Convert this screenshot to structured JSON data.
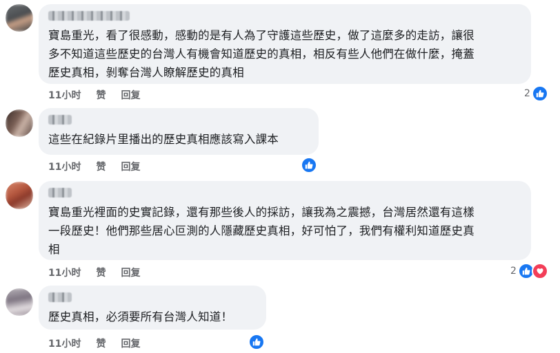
{
  "comments": [
    {
      "text": "寶島重光，看了很感動，感動的是有人為了守護這些歷史，做了這麼多的走訪，讓很\n多不知道這些歷史的台灣人有機會知道歷史的真相，相反有些人他們在做什麼，掩蓋\n歷史真相，剝奪台灣人瞭解歷史的真相",
      "time": "11小时",
      "like": "赞",
      "reply": "回复",
      "reaction_count": "2",
      "reactions": [
        "like-icon"
      ]
    },
    {
      "text": "這些在紀錄片里播出的歷史真相應該寫入課本",
      "time": "11小时",
      "like": "赞",
      "reply": "回复",
      "reaction_count": "",
      "reactions": [
        "like-icon"
      ]
    },
    {
      "text": "寶島重光裡面的史實記錄，還有那些後人的採訪，讓我為之震撼，台灣居然還有這樣\n一段歷史！他們那些居心叵測的人隱藏歷史真相，好可怕了，我們有權利知道歷史真\n相",
      "time": "11小时",
      "like": "赞",
      "reply": "回复",
      "reaction_count": "2",
      "reactions": [
        "like-icon",
        "love-icon"
      ]
    },
    {
      "text": "歷史真相，必須要所有台灣人知道！",
      "time": "11小时",
      "like": "赞",
      "reply": "回复",
      "reaction_count": "",
      "reactions": [
        "like-icon"
      ]
    }
  ],
  "colors": {
    "bubble": "#f0f2f5",
    "like": "#1877f2",
    "love": "#f33e58",
    "meta": "#65676b"
  }
}
